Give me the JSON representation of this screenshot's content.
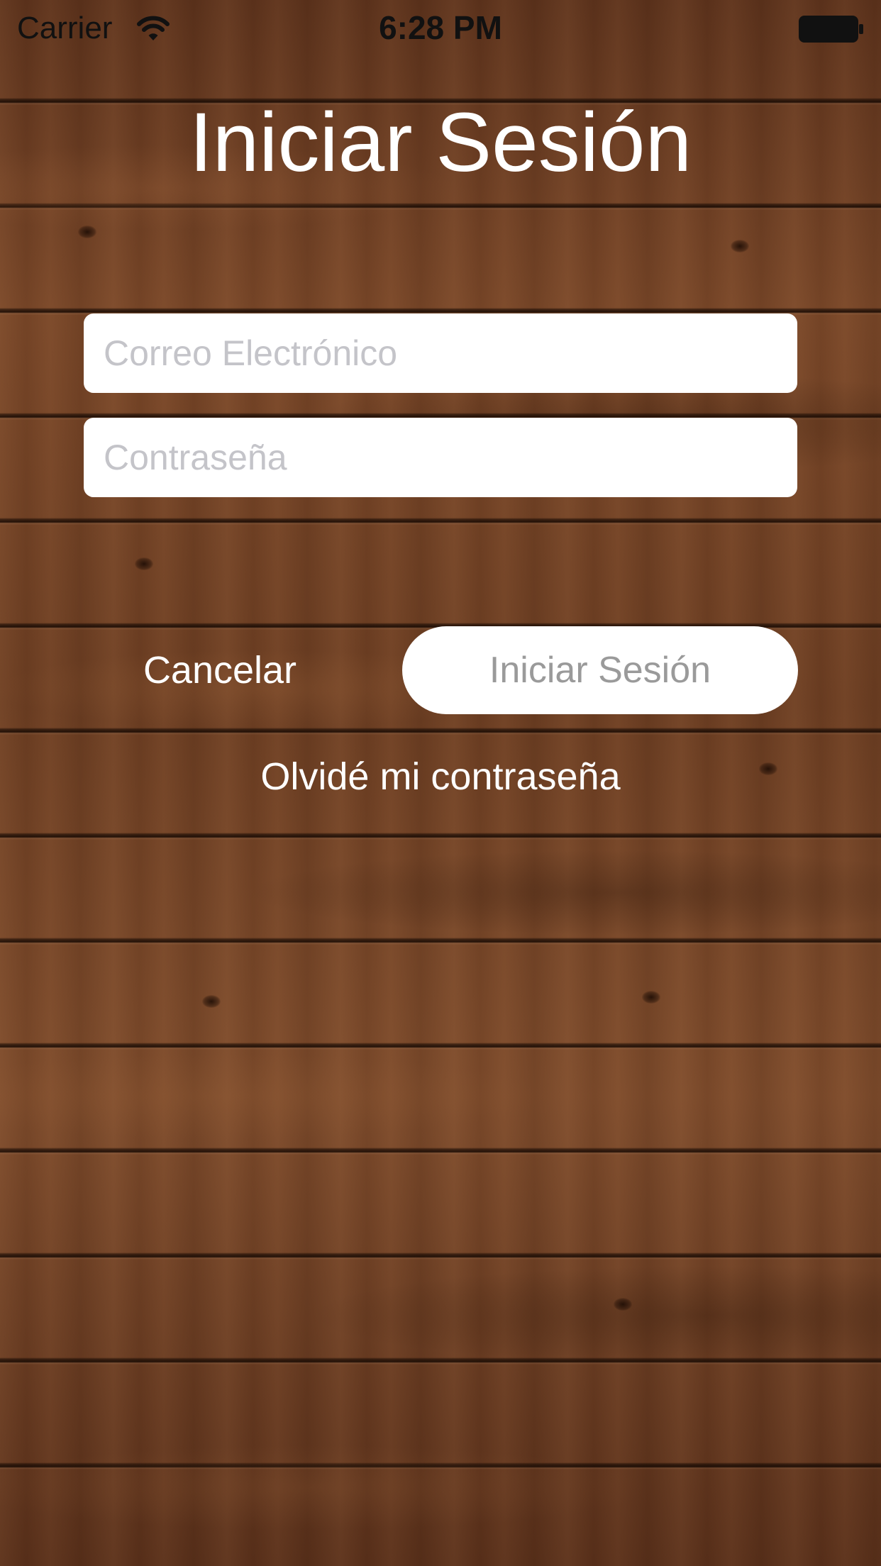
{
  "status_bar": {
    "carrier": "Carrier",
    "time": "6:28 PM",
    "wifi_icon": "wifi-icon",
    "battery_icon": "battery-icon"
  },
  "title": "Iniciar Sesión",
  "form": {
    "email_placeholder": "Correo Electrónico",
    "email_value": "",
    "password_placeholder": "Contraseña",
    "password_value": ""
  },
  "actions": {
    "cancel_label": "Cancelar",
    "login_label": "Iniciar Sesión",
    "forgot_label": "Olvidé mi contraseña"
  },
  "colors": {
    "background_wood": "#6b3d22",
    "text_light": "#ffffff",
    "field_background": "#ffffff",
    "placeholder": "#c4c4c9",
    "login_button_text": "#9a9a9a"
  }
}
